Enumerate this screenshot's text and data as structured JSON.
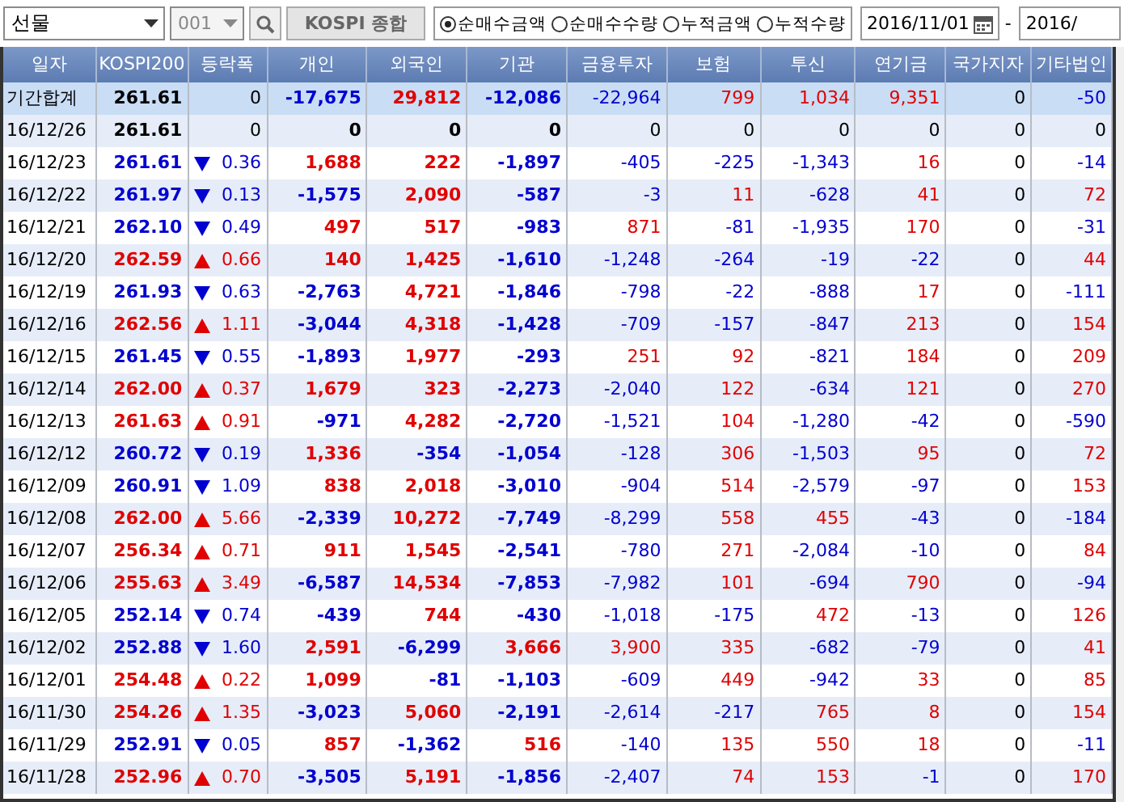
{
  "toolbar": {
    "market": "선물",
    "code": "001",
    "index_button": "KOSPI 종합",
    "modes": [
      {
        "label": "순매수금액",
        "selected": true
      },
      {
        "label": "순매수수량",
        "selected": false
      },
      {
        "label": "누적금액",
        "selected": false
      },
      {
        "label": "누적수량",
        "selected": false
      }
    ],
    "date_from": "2016/11/01",
    "separator": "-",
    "date_to": "2016/"
  },
  "table": {
    "columns": [
      "일자",
      "KOSPI200",
      "등락폭",
      "개인",
      "외국인",
      "기관",
      "금융투자",
      "보험",
      "투신",
      "연기금",
      "국가지자",
      "기타법인"
    ],
    "rows": [
      {
        "kind": "total",
        "date": "기간합계",
        "kospi": {
          "text": "261.61",
          "color": "#000000"
        },
        "change": {
          "kind": "none",
          "text": "0",
          "color": "#000000"
        },
        "values": [
          {
            "text": "-17,675",
            "color": "#0000d0"
          },
          {
            "text": "29,812",
            "color": "#e00000"
          },
          {
            "text": "-12,086",
            "color": "#0000d0"
          },
          {
            "text": "-22,964",
            "color": "#0000d0"
          },
          {
            "text": "799",
            "color": "#e00000"
          },
          {
            "text": "1,034",
            "color": "#e00000"
          },
          {
            "text": "9,351",
            "color": "#e00000"
          },
          {
            "text": "0",
            "color": "#000000"
          },
          {
            "text": "-50",
            "color": "#0000d0"
          }
        ]
      },
      {
        "kind": "day",
        "date": "16/12/26",
        "kospi": {
          "text": "261.61",
          "color": "#000000"
        },
        "change": {
          "kind": "none",
          "text": "0",
          "color": "#000000"
        },
        "values": [
          {
            "text": "0",
            "color": "#000000"
          },
          {
            "text": "0",
            "color": "#000000"
          },
          {
            "text": "0",
            "color": "#000000"
          },
          {
            "text": "0",
            "color": "#000000"
          },
          {
            "text": "0",
            "color": "#000000"
          },
          {
            "text": "0",
            "color": "#000000"
          },
          {
            "text": "0",
            "color": "#000000"
          },
          {
            "text": "0",
            "color": "#000000"
          },
          {
            "text": "0",
            "color": "#000000"
          }
        ]
      },
      {
        "kind": "day",
        "date": "16/12/23",
        "kospi": {
          "text": "261.61",
          "color": "#0000d0"
        },
        "change": {
          "kind": "down",
          "text": "0.36",
          "color": "#0000d0"
        },
        "values": [
          {
            "text": "1,688",
            "color": "#e00000"
          },
          {
            "text": "222",
            "color": "#e00000"
          },
          {
            "text": "-1,897",
            "color": "#0000d0"
          },
          {
            "text": "-405",
            "color": "#0000d0"
          },
          {
            "text": "-225",
            "color": "#0000d0"
          },
          {
            "text": "-1,343",
            "color": "#0000d0"
          },
          {
            "text": "16",
            "color": "#e00000"
          },
          {
            "text": "0",
            "color": "#000000"
          },
          {
            "text": "-14",
            "color": "#0000d0"
          }
        ]
      },
      {
        "kind": "day",
        "date": "16/12/22",
        "kospi": {
          "text": "261.97",
          "color": "#0000d0"
        },
        "change": {
          "kind": "down",
          "text": "0.13",
          "color": "#0000d0"
        },
        "values": [
          {
            "text": "-1,575",
            "color": "#0000d0"
          },
          {
            "text": "2,090",
            "color": "#e00000"
          },
          {
            "text": "-587",
            "color": "#0000d0"
          },
          {
            "text": "-3",
            "color": "#0000d0"
          },
          {
            "text": "11",
            "color": "#e00000"
          },
          {
            "text": "-628",
            "color": "#0000d0"
          },
          {
            "text": "41",
            "color": "#e00000"
          },
          {
            "text": "0",
            "color": "#000000"
          },
          {
            "text": "72",
            "color": "#e00000"
          }
        ]
      },
      {
        "kind": "day",
        "date": "16/12/21",
        "kospi": {
          "text": "262.10",
          "color": "#0000d0"
        },
        "change": {
          "kind": "down",
          "text": "0.49",
          "color": "#0000d0"
        },
        "values": [
          {
            "text": "497",
            "color": "#e00000"
          },
          {
            "text": "517",
            "color": "#e00000"
          },
          {
            "text": "-983",
            "color": "#0000d0"
          },
          {
            "text": "871",
            "color": "#e00000"
          },
          {
            "text": "-81",
            "color": "#0000d0"
          },
          {
            "text": "-1,935",
            "color": "#0000d0"
          },
          {
            "text": "170",
            "color": "#e00000"
          },
          {
            "text": "0",
            "color": "#000000"
          },
          {
            "text": "-31",
            "color": "#0000d0"
          }
        ]
      },
      {
        "kind": "day",
        "date": "16/12/20",
        "kospi": {
          "text": "262.59",
          "color": "#e00000"
        },
        "change": {
          "kind": "up",
          "text": "0.66",
          "color": "#e00000"
        },
        "values": [
          {
            "text": "140",
            "color": "#e00000"
          },
          {
            "text": "1,425",
            "color": "#e00000"
          },
          {
            "text": "-1,610",
            "color": "#0000d0"
          },
          {
            "text": "-1,248",
            "color": "#0000d0"
          },
          {
            "text": "-264",
            "color": "#0000d0"
          },
          {
            "text": "-19",
            "color": "#0000d0"
          },
          {
            "text": "-22",
            "color": "#0000d0"
          },
          {
            "text": "0",
            "color": "#000000"
          },
          {
            "text": "44",
            "color": "#e00000"
          }
        ]
      },
      {
        "kind": "day",
        "date": "16/12/19",
        "kospi": {
          "text": "261.93",
          "color": "#0000d0"
        },
        "change": {
          "kind": "down",
          "text": "0.63",
          "color": "#0000d0"
        },
        "values": [
          {
            "text": "-2,763",
            "color": "#0000d0"
          },
          {
            "text": "4,721",
            "color": "#e00000"
          },
          {
            "text": "-1,846",
            "color": "#0000d0"
          },
          {
            "text": "-798",
            "color": "#0000d0"
          },
          {
            "text": "-22",
            "color": "#0000d0"
          },
          {
            "text": "-888",
            "color": "#0000d0"
          },
          {
            "text": "17",
            "color": "#e00000"
          },
          {
            "text": "0",
            "color": "#000000"
          },
          {
            "text": "-111",
            "color": "#0000d0"
          }
        ]
      },
      {
        "kind": "day",
        "date": "16/12/16",
        "kospi": {
          "text": "262.56",
          "color": "#e00000"
        },
        "change": {
          "kind": "up",
          "text": "1.11",
          "color": "#e00000"
        },
        "values": [
          {
            "text": "-3,044",
            "color": "#0000d0"
          },
          {
            "text": "4,318",
            "color": "#e00000"
          },
          {
            "text": "-1,428",
            "color": "#0000d0"
          },
          {
            "text": "-709",
            "color": "#0000d0"
          },
          {
            "text": "-157",
            "color": "#0000d0"
          },
          {
            "text": "-847",
            "color": "#0000d0"
          },
          {
            "text": "213",
            "color": "#e00000"
          },
          {
            "text": "0",
            "color": "#000000"
          },
          {
            "text": "154",
            "color": "#e00000"
          }
        ]
      },
      {
        "kind": "day",
        "date": "16/12/15",
        "kospi": {
          "text": "261.45",
          "color": "#0000d0"
        },
        "change": {
          "kind": "down",
          "text": "0.55",
          "color": "#0000d0"
        },
        "values": [
          {
            "text": "-1,893",
            "color": "#0000d0"
          },
          {
            "text": "1,977",
            "color": "#e00000"
          },
          {
            "text": "-293",
            "color": "#0000d0"
          },
          {
            "text": "251",
            "color": "#e00000"
          },
          {
            "text": "92",
            "color": "#e00000"
          },
          {
            "text": "-821",
            "color": "#0000d0"
          },
          {
            "text": "184",
            "color": "#e00000"
          },
          {
            "text": "0",
            "color": "#000000"
          },
          {
            "text": "209",
            "color": "#e00000"
          }
        ]
      },
      {
        "kind": "day",
        "date": "16/12/14",
        "kospi": {
          "text": "262.00",
          "color": "#e00000"
        },
        "change": {
          "kind": "up",
          "text": "0.37",
          "color": "#e00000"
        },
        "values": [
          {
            "text": "1,679",
            "color": "#e00000"
          },
          {
            "text": "323",
            "color": "#e00000"
          },
          {
            "text": "-2,273",
            "color": "#0000d0"
          },
          {
            "text": "-2,040",
            "color": "#0000d0"
          },
          {
            "text": "122",
            "color": "#e00000"
          },
          {
            "text": "-634",
            "color": "#0000d0"
          },
          {
            "text": "121",
            "color": "#e00000"
          },
          {
            "text": "0",
            "color": "#000000"
          },
          {
            "text": "270",
            "color": "#e00000"
          }
        ]
      },
      {
        "kind": "day",
        "date": "16/12/13",
        "kospi": {
          "text": "261.63",
          "color": "#e00000"
        },
        "change": {
          "kind": "up",
          "text": "0.91",
          "color": "#e00000"
        },
        "values": [
          {
            "text": "-971",
            "color": "#0000d0"
          },
          {
            "text": "4,282",
            "color": "#e00000"
          },
          {
            "text": "-2,720",
            "color": "#0000d0"
          },
          {
            "text": "-1,521",
            "color": "#0000d0"
          },
          {
            "text": "104",
            "color": "#e00000"
          },
          {
            "text": "-1,280",
            "color": "#0000d0"
          },
          {
            "text": "-42",
            "color": "#0000d0"
          },
          {
            "text": "0",
            "color": "#000000"
          },
          {
            "text": "-590",
            "color": "#0000d0"
          }
        ]
      },
      {
        "kind": "day",
        "date": "16/12/12",
        "kospi": {
          "text": "260.72",
          "color": "#0000d0"
        },
        "change": {
          "kind": "down",
          "text": "0.19",
          "color": "#0000d0"
        },
        "values": [
          {
            "text": "1,336",
            "color": "#e00000"
          },
          {
            "text": "-354",
            "color": "#0000d0"
          },
          {
            "text": "-1,054",
            "color": "#0000d0"
          },
          {
            "text": "-128",
            "color": "#0000d0"
          },
          {
            "text": "306",
            "color": "#e00000"
          },
          {
            "text": "-1,503",
            "color": "#0000d0"
          },
          {
            "text": "95",
            "color": "#e00000"
          },
          {
            "text": "0",
            "color": "#000000"
          },
          {
            "text": "72",
            "color": "#e00000"
          }
        ]
      },
      {
        "kind": "day",
        "date": "16/12/09",
        "kospi": {
          "text": "260.91",
          "color": "#0000d0"
        },
        "change": {
          "kind": "down",
          "text": "1.09",
          "color": "#0000d0"
        },
        "values": [
          {
            "text": "838",
            "color": "#e00000"
          },
          {
            "text": "2,018",
            "color": "#e00000"
          },
          {
            "text": "-3,010",
            "color": "#0000d0"
          },
          {
            "text": "-904",
            "color": "#0000d0"
          },
          {
            "text": "514",
            "color": "#e00000"
          },
          {
            "text": "-2,579",
            "color": "#0000d0"
          },
          {
            "text": "-97",
            "color": "#0000d0"
          },
          {
            "text": "0",
            "color": "#000000"
          },
          {
            "text": "153",
            "color": "#e00000"
          }
        ]
      },
      {
        "kind": "day",
        "date": "16/12/08",
        "kospi": {
          "text": "262.00",
          "color": "#e00000"
        },
        "change": {
          "kind": "up",
          "text": "5.66",
          "color": "#e00000"
        },
        "values": [
          {
            "text": "-2,339",
            "color": "#0000d0"
          },
          {
            "text": "10,272",
            "color": "#e00000"
          },
          {
            "text": "-7,749",
            "color": "#0000d0"
          },
          {
            "text": "-8,299",
            "color": "#0000d0"
          },
          {
            "text": "558",
            "color": "#e00000"
          },
          {
            "text": "455",
            "color": "#e00000"
          },
          {
            "text": "-43",
            "color": "#0000d0"
          },
          {
            "text": "0",
            "color": "#000000"
          },
          {
            "text": "-184",
            "color": "#0000d0"
          }
        ]
      },
      {
        "kind": "day",
        "date": "16/12/07",
        "kospi": {
          "text": "256.34",
          "color": "#e00000"
        },
        "change": {
          "kind": "up",
          "text": "0.71",
          "color": "#e00000"
        },
        "values": [
          {
            "text": "911",
            "color": "#e00000"
          },
          {
            "text": "1,545",
            "color": "#e00000"
          },
          {
            "text": "-2,541",
            "color": "#0000d0"
          },
          {
            "text": "-780",
            "color": "#0000d0"
          },
          {
            "text": "271",
            "color": "#e00000"
          },
          {
            "text": "-2,084",
            "color": "#0000d0"
          },
          {
            "text": "-10",
            "color": "#0000d0"
          },
          {
            "text": "0",
            "color": "#000000"
          },
          {
            "text": "84",
            "color": "#e00000"
          }
        ]
      },
      {
        "kind": "day",
        "date": "16/12/06",
        "kospi": {
          "text": "255.63",
          "color": "#e00000"
        },
        "change": {
          "kind": "up",
          "text": "3.49",
          "color": "#e00000"
        },
        "values": [
          {
            "text": "-6,587",
            "color": "#0000d0"
          },
          {
            "text": "14,534",
            "color": "#e00000"
          },
          {
            "text": "-7,853",
            "color": "#0000d0"
          },
          {
            "text": "-7,982",
            "color": "#0000d0"
          },
          {
            "text": "101",
            "color": "#e00000"
          },
          {
            "text": "-694",
            "color": "#0000d0"
          },
          {
            "text": "790",
            "color": "#e00000"
          },
          {
            "text": "0",
            "color": "#000000"
          },
          {
            "text": "-94",
            "color": "#0000d0"
          }
        ]
      },
      {
        "kind": "day",
        "date": "16/12/05",
        "kospi": {
          "text": "252.14",
          "color": "#0000d0"
        },
        "change": {
          "kind": "down",
          "text": "0.74",
          "color": "#0000d0"
        },
        "values": [
          {
            "text": "-439",
            "color": "#0000d0"
          },
          {
            "text": "744",
            "color": "#e00000"
          },
          {
            "text": "-430",
            "color": "#0000d0"
          },
          {
            "text": "-1,018",
            "color": "#0000d0"
          },
          {
            "text": "-175",
            "color": "#0000d0"
          },
          {
            "text": "472",
            "color": "#e00000"
          },
          {
            "text": "-13",
            "color": "#0000d0"
          },
          {
            "text": "0",
            "color": "#000000"
          },
          {
            "text": "126",
            "color": "#e00000"
          }
        ]
      },
      {
        "kind": "day",
        "date": "16/12/02",
        "kospi": {
          "text": "252.88",
          "color": "#0000d0"
        },
        "change": {
          "kind": "down",
          "text": "1.60",
          "color": "#0000d0"
        },
        "values": [
          {
            "text": "2,591",
            "color": "#e00000"
          },
          {
            "text": "-6,299",
            "color": "#0000d0"
          },
          {
            "text": "3,666",
            "color": "#e00000"
          },
          {
            "text": "3,900",
            "color": "#e00000"
          },
          {
            "text": "335",
            "color": "#e00000"
          },
          {
            "text": "-682",
            "color": "#0000d0"
          },
          {
            "text": "-79",
            "color": "#0000d0"
          },
          {
            "text": "0",
            "color": "#000000"
          },
          {
            "text": "41",
            "color": "#e00000"
          }
        ]
      },
      {
        "kind": "day",
        "date": "16/12/01",
        "kospi": {
          "text": "254.48",
          "color": "#e00000"
        },
        "change": {
          "kind": "up",
          "text": "0.22",
          "color": "#e00000"
        },
        "values": [
          {
            "text": "1,099",
            "color": "#e00000"
          },
          {
            "text": "-81",
            "color": "#0000d0"
          },
          {
            "text": "-1,103",
            "color": "#0000d0"
          },
          {
            "text": "-609",
            "color": "#0000d0"
          },
          {
            "text": "449",
            "color": "#e00000"
          },
          {
            "text": "-942",
            "color": "#0000d0"
          },
          {
            "text": "33",
            "color": "#e00000"
          },
          {
            "text": "0",
            "color": "#000000"
          },
          {
            "text": "85",
            "color": "#e00000"
          }
        ]
      },
      {
        "kind": "day",
        "date": "16/11/30",
        "kospi": {
          "text": "254.26",
          "color": "#e00000"
        },
        "change": {
          "kind": "up",
          "text": "1.35",
          "color": "#e00000"
        },
        "values": [
          {
            "text": "-3,023",
            "color": "#0000d0"
          },
          {
            "text": "5,060",
            "color": "#e00000"
          },
          {
            "text": "-2,191",
            "color": "#0000d0"
          },
          {
            "text": "-2,614",
            "color": "#0000d0"
          },
          {
            "text": "-217",
            "color": "#0000d0"
          },
          {
            "text": "765",
            "color": "#e00000"
          },
          {
            "text": "8",
            "color": "#e00000"
          },
          {
            "text": "0",
            "color": "#000000"
          },
          {
            "text": "154",
            "color": "#e00000"
          }
        ]
      },
      {
        "kind": "day",
        "date": "16/11/29",
        "kospi": {
          "text": "252.91",
          "color": "#0000d0"
        },
        "change": {
          "kind": "down",
          "text": "0.05",
          "color": "#0000d0"
        },
        "values": [
          {
            "text": "857",
            "color": "#e00000"
          },
          {
            "text": "-1,362",
            "color": "#0000d0"
          },
          {
            "text": "516",
            "color": "#e00000"
          },
          {
            "text": "-140",
            "color": "#0000d0"
          },
          {
            "text": "135",
            "color": "#e00000"
          },
          {
            "text": "550",
            "color": "#e00000"
          },
          {
            "text": "18",
            "color": "#e00000"
          },
          {
            "text": "0",
            "color": "#000000"
          },
          {
            "text": "-11",
            "color": "#0000d0"
          }
        ]
      },
      {
        "kind": "day",
        "date": "16/11/28",
        "kospi": {
          "text": "252.96",
          "color": "#e00000"
        },
        "change": {
          "kind": "up",
          "text": "0.70",
          "color": "#e00000"
        },
        "values": [
          {
            "text": "-3,505",
            "color": "#0000d0"
          },
          {
            "text": "5,191",
            "color": "#e00000"
          },
          {
            "text": "-1,856",
            "color": "#0000d0"
          },
          {
            "text": "-2,407",
            "color": "#0000d0"
          },
          {
            "text": "74",
            "color": "#e00000"
          },
          {
            "text": "153",
            "color": "#e00000"
          },
          {
            "text": "-1",
            "color": "#0000d0"
          },
          {
            "text": "0",
            "color": "#000000"
          },
          {
            "text": "170",
            "color": "#e00000"
          }
        ]
      }
    ]
  }
}
